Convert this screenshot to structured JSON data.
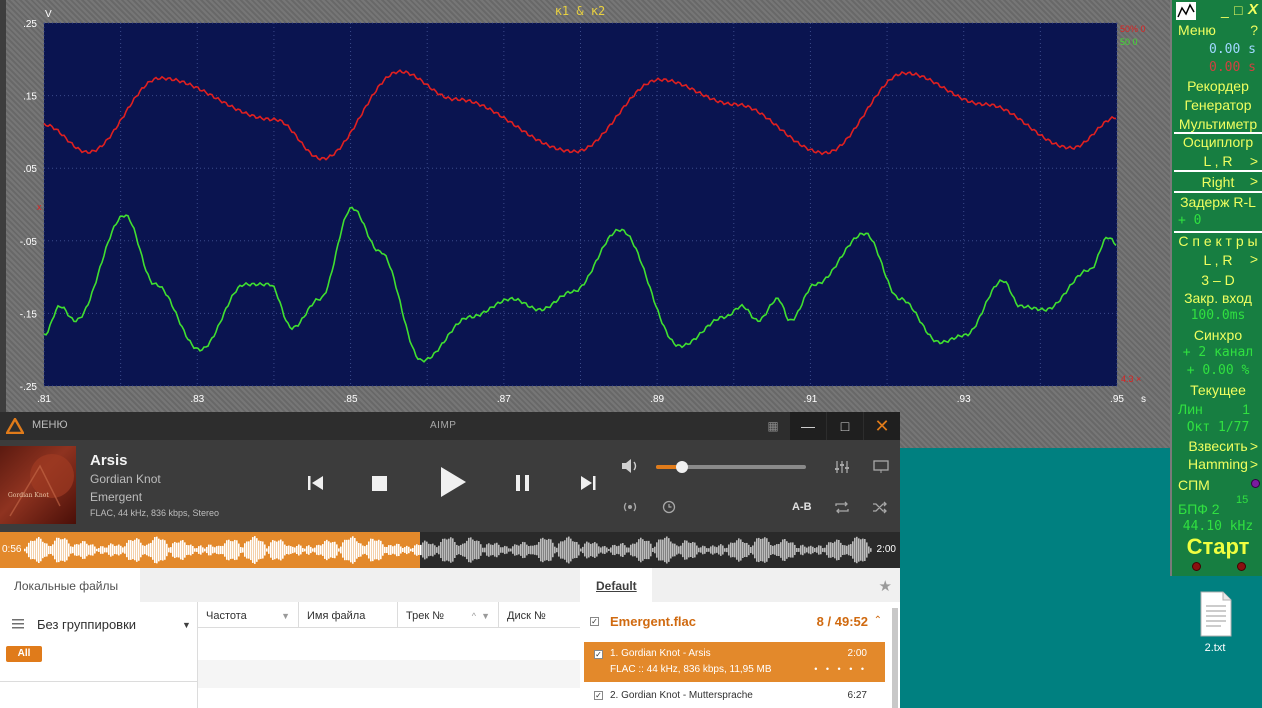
{
  "oscilloscope": {
    "title": "к1 & к2",
    "y_unit": "V",
    "x_unit": "s",
    "y_ticks": [
      ".25",
      ".15",
      ".05",
      "-.05",
      "-.15",
      "-.25"
    ],
    "x_ticks": [
      ".81",
      ".83",
      ".85",
      ".87",
      ".89",
      ".91",
      ".93",
      ".95"
    ],
    "channel_readout_red": "50% 0",
    "channel_readout_green": "50 0",
    "corner_bottom_right": "4.3 ×",
    "colors": {
      "plot_bg": "#0a1450",
      "red_trace": "#e02020",
      "green_trace": "#40e030",
      "panel_bg": "#177e41"
    }
  },
  "panel": {
    "icon": "app-icon",
    "min_btn": "_",
    "max_btn": "□",
    "close_btn": "X",
    "menu_label": "Меню",
    "help_label": "?",
    "time1": "0.00 s",
    "time2": "0.00 s",
    "recorder": "Рекордер",
    "generator": "Генератор",
    "multimeter": "Мультиметр",
    "oscillograph": "Осциплогр",
    "osc_channels": "L , R",
    "right": "Right",
    "delay": "Задерж R-L",
    "delay_value": "+     0",
    "spectra": "С п е к т р ы",
    "spec_channels": "L , R",
    "three_d": "3 – D",
    "gate": "Закр. вход",
    "gate_value": "100.0ms",
    "sync": "Синхро",
    "sync_channel": "+ 2 канал",
    "sync_percent": "+ 0.00 %",
    "current": "Текущее",
    "lin": "Лин",
    "lin_value": "1",
    "oct": "Окт 1/77",
    "weigh": "Взвесить",
    "hamming": "Hamming",
    "spm": "СПМ",
    "fft": "БПФ  2",
    "fft_exp": "15",
    "sample_rate": "44.10 kHz",
    "start": "Старт"
  },
  "aimp": {
    "menu_label": "МЕНЮ",
    "window_title": "AIMP",
    "track": {
      "title": "Arsis",
      "artist": "Gordian Knot",
      "album": "Emergent",
      "info": "FLAC, 44 kHz, 836 kbps, Stereo",
      "cover_text": "Gordian Knot"
    },
    "volume_level": 0.17,
    "ab_label": "A-B",
    "progress": 0.467,
    "time_elapsed": "0:56",
    "time_total": "2:00"
  },
  "library": {
    "tab_label": "Локальные файлы",
    "grouping_label": "Без группировки",
    "all_chip": "All",
    "columns": [
      "Частота",
      "Имя файла",
      "Трек №",
      "Диск №"
    ]
  },
  "playlist": {
    "tab_label": "Default",
    "file_label": "Emergent.flac",
    "count_label": "8 / 49:52",
    "rows": [
      {
        "title": "1. Gordian Knot - Arsis",
        "info": "FLAC :: 44 kHz, 836 kbps, 11,95 MB",
        "duration": "2:00",
        "rating": "• • • • •"
      },
      {
        "title": "2. Gordian Knot - Muttersprache",
        "duration": "6:27"
      }
    ]
  },
  "desktop": {
    "icon_label": "2.txt"
  }
}
